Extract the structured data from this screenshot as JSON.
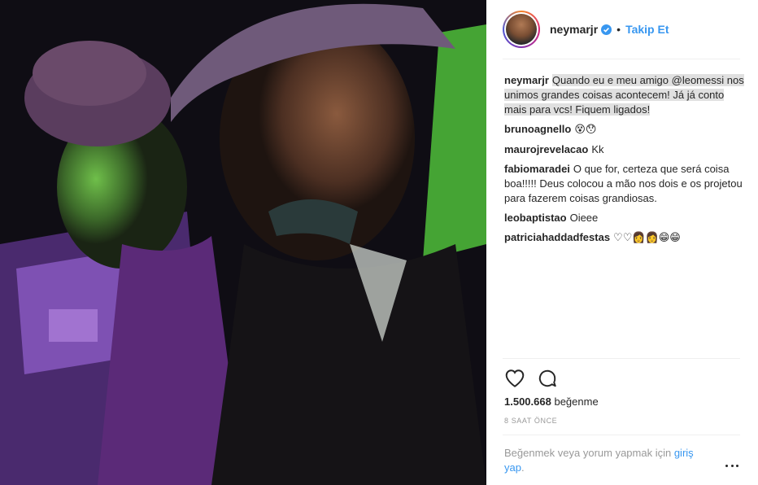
{
  "post": {
    "image_icon": "party-selfie-photo",
    "header": {
      "username": "neymarjr",
      "verified_icon": "verified-badge-icon",
      "separator": "•",
      "follow_label": "Takip Et"
    },
    "comments": [
      {
        "username": "neymarjr",
        "text": "Quando eu e meu amigo @leomessi nos unimos grandes coisas acontecem! Já já conto mais para vcs! Fiquem ligados!"
      },
      {
        "username": "brunoagnello",
        "text": "😵😯"
      },
      {
        "username": "maurojrevelacao",
        "text": "Kk"
      },
      {
        "username": "fabiomaradei",
        "text": "O que for, certeza que será coisa boa!!!!! Deus colocou a mão nos dois e os projetou para fazerem coisas grandiosas."
      },
      {
        "username": "leobaptistao",
        "text": "Oieee"
      },
      {
        "username": "patriciahaddadfestas",
        "text": "♡♡👩👩😁😁"
      }
    ],
    "actions": {
      "like_icon": "heart-icon",
      "comment_icon": "comment-icon"
    },
    "likes": {
      "count": "1.500.668",
      "label": "beğenme"
    },
    "timestamp": "8 SAAT ÖNCE",
    "footer": {
      "prompt": "Beğenmek veya yorum yapmak için",
      "login_link": "giriş yap",
      "suffix": ".",
      "more_icon": "more-options-icon"
    },
    "colors": {
      "link": "#3897f0",
      "text": "#262626",
      "muted": "#999999",
      "highlight": "#e0e0e0"
    }
  }
}
